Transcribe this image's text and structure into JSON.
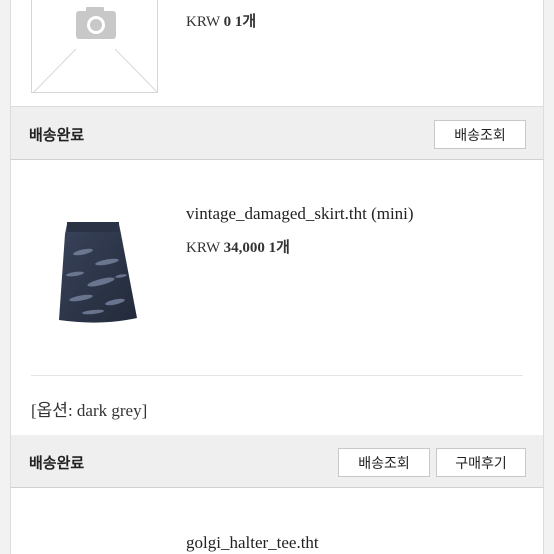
{
  "orders": [
    {
      "product": {
        "image": "image-placeholder-icon",
        "price_currency": "KRW",
        "price_amount": "0",
        "quantity": "1개"
      },
      "status": "배송완료",
      "buttons": {
        "track": "배송조회"
      }
    },
    {
      "product": {
        "name": "vintage_damaged_skirt.tht (mini)",
        "price_currency": "KRW",
        "price_amount": "34,000",
        "quantity": "1개",
        "option": "[옵션: dark grey]"
      },
      "status": "배송완료",
      "buttons": {
        "track": "배송조회",
        "review": "구매후기"
      }
    },
    {
      "product": {
        "name": "golgi_halter_tee.tht"
      }
    }
  ],
  "colors": {
    "background": "#f2f2f2",
    "status_bar": "#efefef",
    "card": "#ffffff",
    "border": "#dcdcdc",
    "skirt": "#2b3448"
  }
}
